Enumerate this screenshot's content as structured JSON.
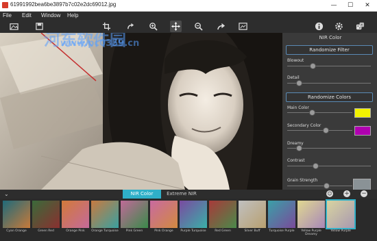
{
  "window": {
    "title": "61991992bea6be3897b7c02e2dc69012.jpg",
    "minimize": "—",
    "maximize": "☐",
    "close": "✕"
  },
  "menu": [
    "File",
    "Edit",
    "Window",
    "Help"
  ],
  "watermark": {
    "line1": "河东软件园",
    "line2": "www.pc0359.cn"
  },
  "panel": {
    "title": "NIR Color",
    "randomize_filter": "Randomize Filter",
    "blowout_label": "Blowout",
    "detail_label": "Detail",
    "randomize_colors": "Randomize Colors",
    "main_color_label": "Main Color",
    "secondary_color_label": "Secondary Color",
    "dreamy_label": "Dreamy",
    "contrast_label": "Contrast",
    "grain_label": "Grain Strength",
    "main_color": "#f2f200",
    "secondary_color": "#b000b0",
    "grain_swatch": "#8a9296"
  },
  "tabs": [
    "NIR Color",
    "Extreme NIR"
  ],
  "presets": [
    "Cyan Orange",
    "Green Red",
    "Orange Pink",
    "Orange Turquoise",
    "Pink Green",
    "Pink Orange",
    "Purple Turquoise",
    "Red Green",
    "Silver Buff",
    "Turquoise Purple",
    "Yellow Purple Dreamy",
    "Yellow Purple"
  ]
}
